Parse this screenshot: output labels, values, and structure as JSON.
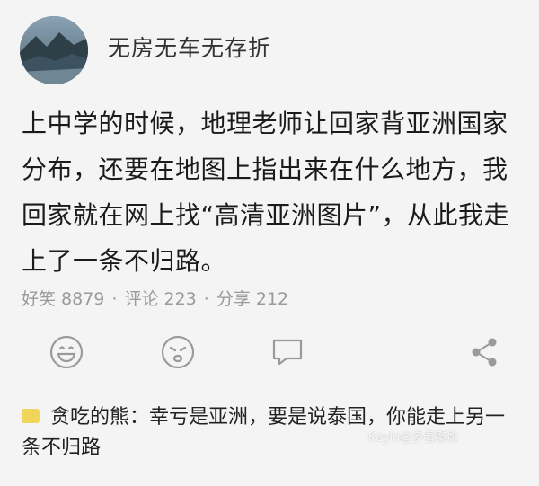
{
  "post": {
    "author": "无房无车无存折",
    "content": "上中学的时候，地理老师让回家背亚洲国家分布，还要在地图上指出来在什么地方，我回家就在网上找“高清亚洲图片”，从此我走上了一条不归路。",
    "stats": {
      "likes": "好笑 8879",
      "comments": "评论 223",
      "shares": "分享 212",
      "separator": "·"
    }
  },
  "actions": [
    {
      "icon": "laugh-face-icon"
    },
    {
      "icon": "sad-face-icon"
    },
    {
      "icon": "comment-bubble-icon"
    },
    {
      "icon": "share-icon"
    }
  ],
  "top_comment": {
    "text": "贪吃的熊：幸亏是亚洲，要是说泰国，你能走上另一条不归路"
  },
  "watermark": "Keyin@多看聚影",
  "colors": {
    "background": "#f4f4f4",
    "text": "#1b1b1b",
    "muted": "#9a9a9a",
    "marker": "#f1d55a"
  }
}
